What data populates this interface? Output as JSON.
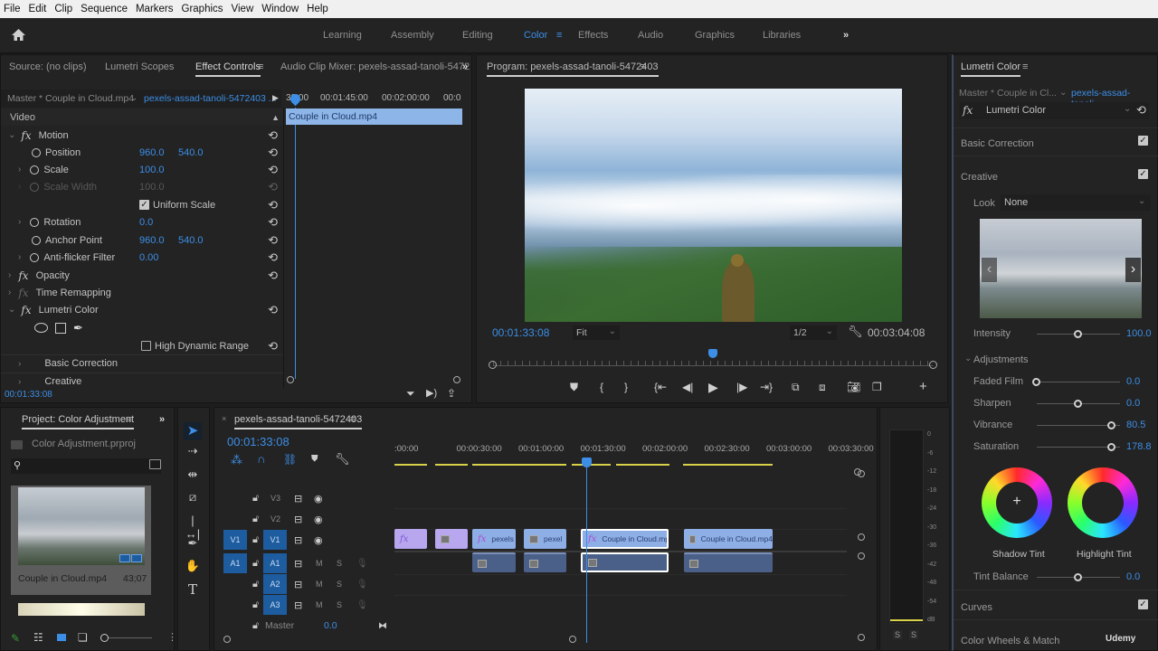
{
  "menu": [
    "File",
    "Edit",
    "Clip",
    "Sequence",
    "Markers",
    "Graphics",
    "View",
    "Window",
    "Help"
  ],
  "workspaces": [
    "Learning",
    "Assembly",
    "Editing",
    "Color",
    "Effects",
    "Audio",
    "Graphics",
    "Libraries"
  ],
  "workspaces_more": "»",
  "source_panel": {
    "tabs": [
      "Source: (no clips)",
      "Lumetri Scopes",
      "Effect Controls",
      "Audio Clip Mixer: pexels-assad-tanoli-5472"
    ],
    "active_tab": "Effect Controls",
    "more": "»",
    "master_label": "Master * Couple in Cloud.mp4",
    "sequence_link": "pexels-assad-tanoli-5472403 ...",
    "ruler": [
      "30:00",
      "00:01:45:00",
      "00:02:00:00",
      "00:0"
    ],
    "clip_name": "Couple in Cloud.mp4",
    "section": "Video",
    "motion": "Motion",
    "position": {
      "label": "Position",
      "x": "960.0",
      "y": "540.0"
    },
    "scale": {
      "label": "Scale",
      "value": "100.0"
    },
    "scale_width": {
      "label": "Scale Width",
      "value": "100.0"
    },
    "uniform_scale": {
      "label": "Uniform Scale",
      "checked": true
    },
    "rotation": {
      "label": "Rotation",
      "value": "0.0"
    },
    "anchor": {
      "label": "Anchor Point",
      "x": "960.0",
      "y": "540.0"
    },
    "antiflicker": {
      "label": "Anti-flicker Filter",
      "value": "0.00"
    },
    "opacity": "Opacity",
    "time_remap": "Time Remapping",
    "lumetri": "Lumetri Color",
    "hdr": {
      "label": "High Dynamic Range",
      "checked": false
    },
    "basic_correction": "Basic Correction",
    "creative": "Creative",
    "timecode": "00:01:33:08"
  },
  "program": {
    "title": "Program: pexels-assad-tanoli-5472403",
    "timecode": "00:01:33:08",
    "fit": "Fit",
    "resolution": "1/2",
    "duration": "00:03:04:08",
    "playhead_fraction": 0.5
  },
  "project": {
    "title": "Project: Color Adjustment",
    "more": "»",
    "file": "Color Adjustment.prproj",
    "item_name": "Couple in Cloud.mp4",
    "item_duration": "43;07"
  },
  "timeline": {
    "title": "pexels-assad-tanoli-5472403",
    "timecode": "00:01:33:08",
    "ruler": [
      ":00:00",
      "00:00:30:00",
      "00:01:00:00",
      "00:01:30:00",
      "00:02:00:00",
      "00:02:30:00",
      "00:03:00:00",
      "00:03:30:00"
    ],
    "tracks": {
      "video": [
        {
          "name": "V3"
        },
        {
          "name": "V2"
        },
        {
          "name": "V1",
          "src": "V1"
        }
      ],
      "audio": [
        {
          "name": "A1",
          "src": "A1"
        },
        {
          "name": "A2"
        },
        {
          "name": "A3"
        }
      ]
    },
    "mute": "M",
    "solo": "S",
    "master_label": "Master",
    "master_value": "0.0",
    "clips": {
      "c3": "pexels",
      "c4": "pexel",
      "c5": "Couple in Cloud.mp",
      "c6": "Couple in Cloud.mp4"
    }
  },
  "meter": {
    "scale": [
      "0",
      "-6",
      "-12",
      "-18",
      "-24",
      "-30",
      "-36",
      "-42",
      "-48",
      "-54",
      "dB"
    ],
    "solo": [
      "S",
      "S"
    ]
  },
  "lumetri": {
    "title": "Lumetri Color",
    "master_label": "Master * Couple in Cl...",
    "sequence_link": "pexels-assad-tanoli...",
    "effect": "Lumetri Color",
    "basic_correction": "Basic Correction",
    "creative": "Creative",
    "look_label": "Look",
    "look_value": "None",
    "intensity": {
      "label": "Intensity",
      "value": "100.0",
      "fraction": 0.5
    },
    "adjustments": "Adjustments",
    "faded_film": {
      "label": "Faded Film",
      "value": "0.0",
      "fraction": 0.0
    },
    "sharpen": {
      "label": "Sharpen",
      "value": "0.0",
      "fraction": 0.5
    },
    "vibrance": {
      "label": "Vibrance",
      "value": "80.5",
      "fraction": 0.9
    },
    "saturation": {
      "label": "Saturation",
      "value": "178.8",
      "fraction": 0.9
    },
    "shadow_tint": "Shadow Tint",
    "highlight_tint": "Highlight Tint",
    "tint_balance": {
      "label": "Tint Balance",
      "value": "0.0",
      "fraction": 0.5
    },
    "curves": "Curves",
    "color_wheels": "Color Wheels & Match",
    "udemy": "Udemy"
  },
  "colors": {
    "accent": "#3c8ee6",
    "clip_violet": "#b8a6ef",
    "clip_blue": "#8eaee6",
    "audio_clip": "#4a6088",
    "track_active": "#1d5c9e",
    "yellow_bar": "#d8d24a"
  }
}
